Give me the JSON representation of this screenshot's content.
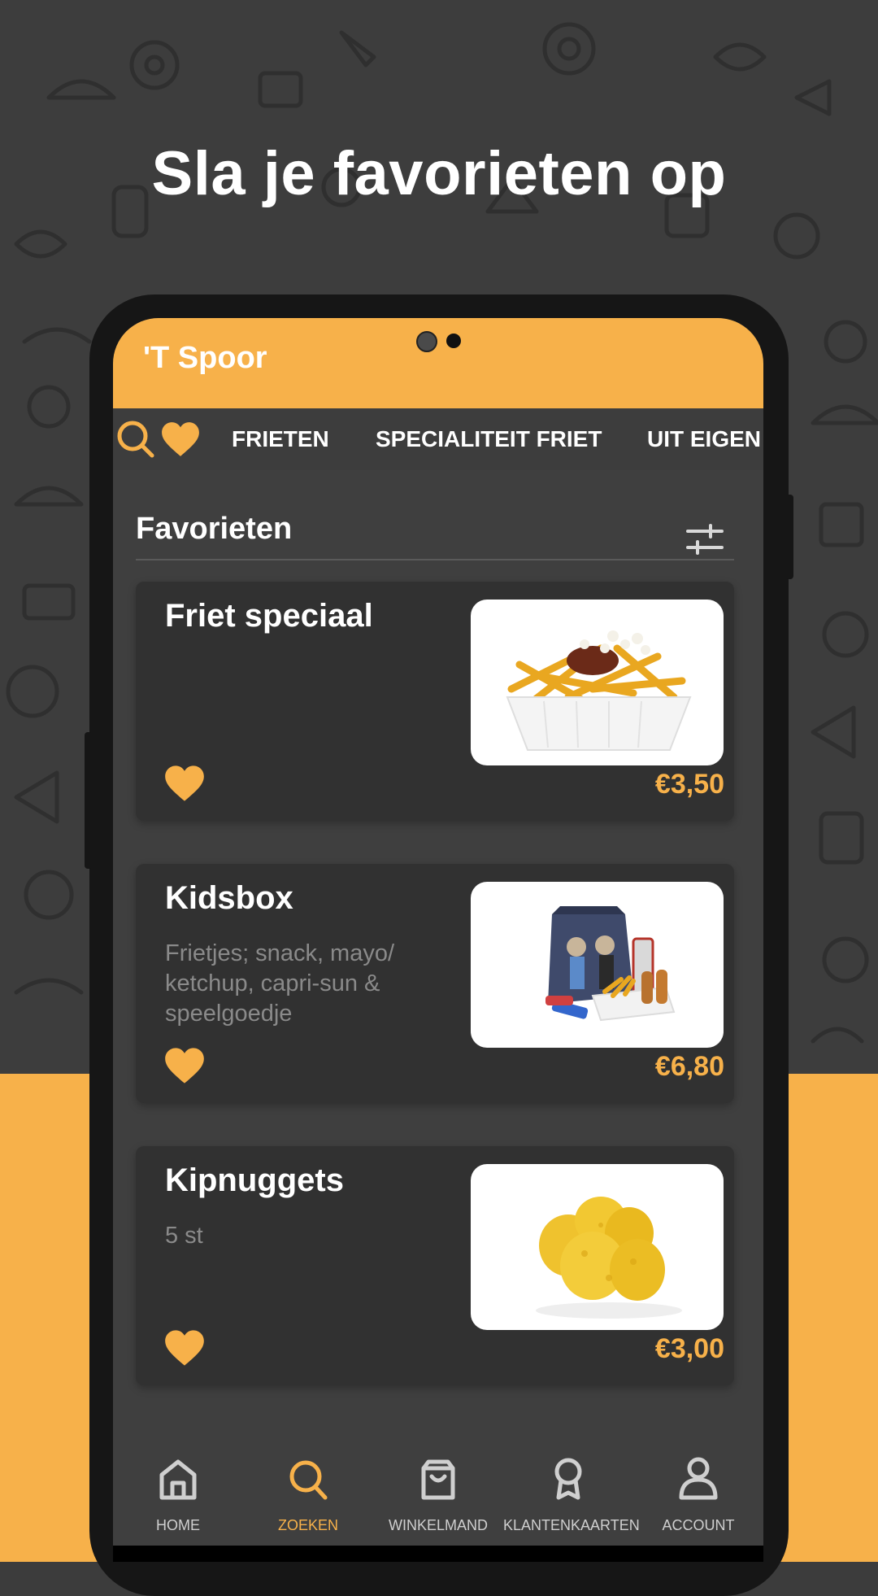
{
  "headline": "Sla je favorieten op",
  "colors": {
    "accent": "#f7b14a",
    "dark_bg": "#3d3d3d",
    "card_bg": "#313131",
    "screen_bg": "#3f3f3f"
  },
  "app": {
    "title": "'T Spoor"
  },
  "tabs": {
    "icons": [
      "search-icon",
      "heart-icon"
    ],
    "items": [
      {
        "label": "FRIETEN"
      },
      {
        "label": "SPECIALITEIT FRIET"
      },
      {
        "label": "UIT EIGEN"
      }
    ]
  },
  "section": {
    "title": "Favorieten",
    "filter_icon": "sliders-icon"
  },
  "products": [
    {
      "name": "Friet speciaal",
      "description": "",
      "price": "€3,50",
      "favorite": true,
      "image": "fries-with-sauce"
    },
    {
      "name": "Kidsbox",
      "description": "Frietjes; snack, mayo/ ketchup, capri-sun & speelgoedje",
      "price": "€6,80",
      "favorite": true,
      "image": "kids-box"
    },
    {
      "name": "Kipnuggets",
      "description": "5 st",
      "price": "€3,00",
      "favorite": true,
      "image": "chicken-nuggets"
    }
  ],
  "bottom_nav": [
    {
      "label": "HOME",
      "icon": "home-icon",
      "active": false
    },
    {
      "label": "ZOEKEN",
      "icon": "search-icon",
      "active": true
    },
    {
      "label": "WINKELMAND",
      "icon": "shopping-bag-icon",
      "active": false
    },
    {
      "label": "KLANTENKAARTEN",
      "icon": "award-icon",
      "active": false
    },
    {
      "label": "ACCOUNT",
      "icon": "user-icon",
      "active": false
    }
  ]
}
